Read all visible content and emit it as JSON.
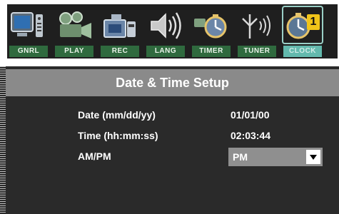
{
  "tabs": [
    {
      "label": "GNRL",
      "icon": "tv-remote-icon"
    },
    {
      "label": "PLAY",
      "icon": "projector-icon"
    },
    {
      "label": "REC",
      "icon": "camcorder-icon"
    },
    {
      "label": "LANG",
      "icon": "speaker-icon"
    },
    {
      "label": "TIMER",
      "icon": "timer-icon"
    },
    {
      "label": "TUNER",
      "icon": "antenna-icon"
    },
    {
      "label": "CLOCK",
      "icon": "clock-icon",
      "badge": "1",
      "active": true
    }
  ],
  "panel": {
    "title": "Date & Time Setup",
    "rows": [
      {
        "label": "Date (mm/dd/yy)",
        "value": "01/01/00"
      },
      {
        "label": "Time (hh:mm:ss)",
        "value": "02:03:44"
      },
      {
        "label": "AM/PM",
        "value": "PM"
      }
    ]
  },
  "colors": {
    "toolbar_bg": "#1f1f1f",
    "tab_label_bg": "#2f6a3e",
    "active_tab_label_bg": "#63b9ad",
    "panel_bg": "#2a2a2a",
    "header_bg": "#8a8a8a",
    "select_bg": "#8f8f8f",
    "badge_bg": "#f0c419"
  }
}
